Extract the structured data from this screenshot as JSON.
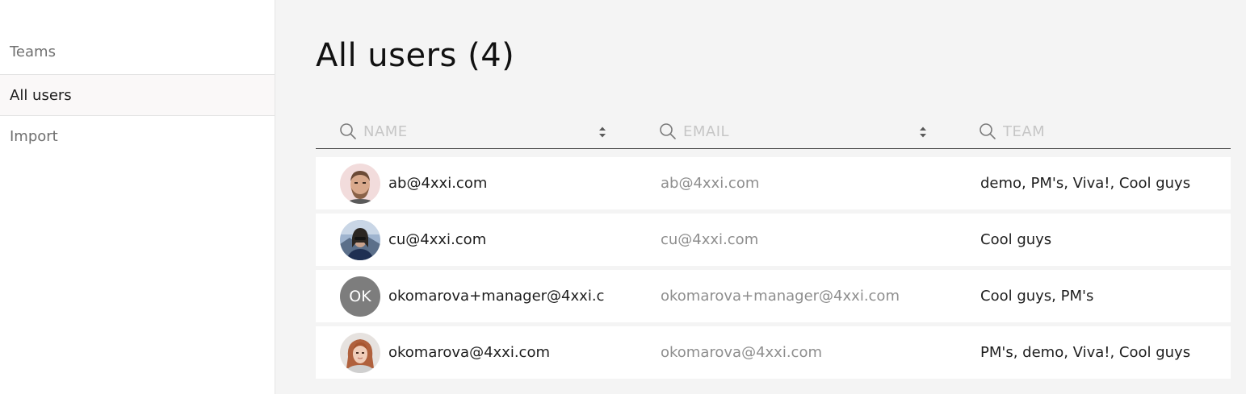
{
  "sidebar": {
    "items": [
      {
        "label": "Teams",
        "active": false
      },
      {
        "label": "All users",
        "active": true
      },
      {
        "label": "Import",
        "active": false
      }
    ]
  },
  "main": {
    "title": "All users (4)",
    "filters": {
      "name_placeholder": "NAME",
      "email_placeholder": "EMAIL",
      "team_placeholder": "TEAM"
    },
    "users": [
      {
        "name": "ab@4xxi.com",
        "email": "ab@4xxi.com",
        "teams": "demo, PM's, Viva!, Cool guys",
        "avatar": "photo-man-beard"
      },
      {
        "name": "cu@4xxi.com",
        "email": "cu@4xxi.com",
        "teams": "Cool guys",
        "avatar": "photo-outdoor-sunglasses"
      },
      {
        "name": "okomarova+manager@4xxi.c",
        "email": "okomarova+manager@4xxi.com",
        "teams": "Cool guys, PM's",
        "avatar": "initials",
        "initials": "OK"
      },
      {
        "name": "okomarova@4xxi.com",
        "email": "okomarova@4xxi.com",
        "teams": "PM's, demo, Viva!, Cool guys",
        "avatar": "photo-woman-redhair"
      }
    ]
  },
  "colors": {
    "background": "#f4f4f4",
    "sidebar": "#ffffff",
    "active_item": "#faf8f8",
    "initials_avatar": "#7d7d7d",
    "muted_text": "#8e8e8e"
  },
  "icons": [
    "search-icon",
    "sort-icon"
  ]
}
